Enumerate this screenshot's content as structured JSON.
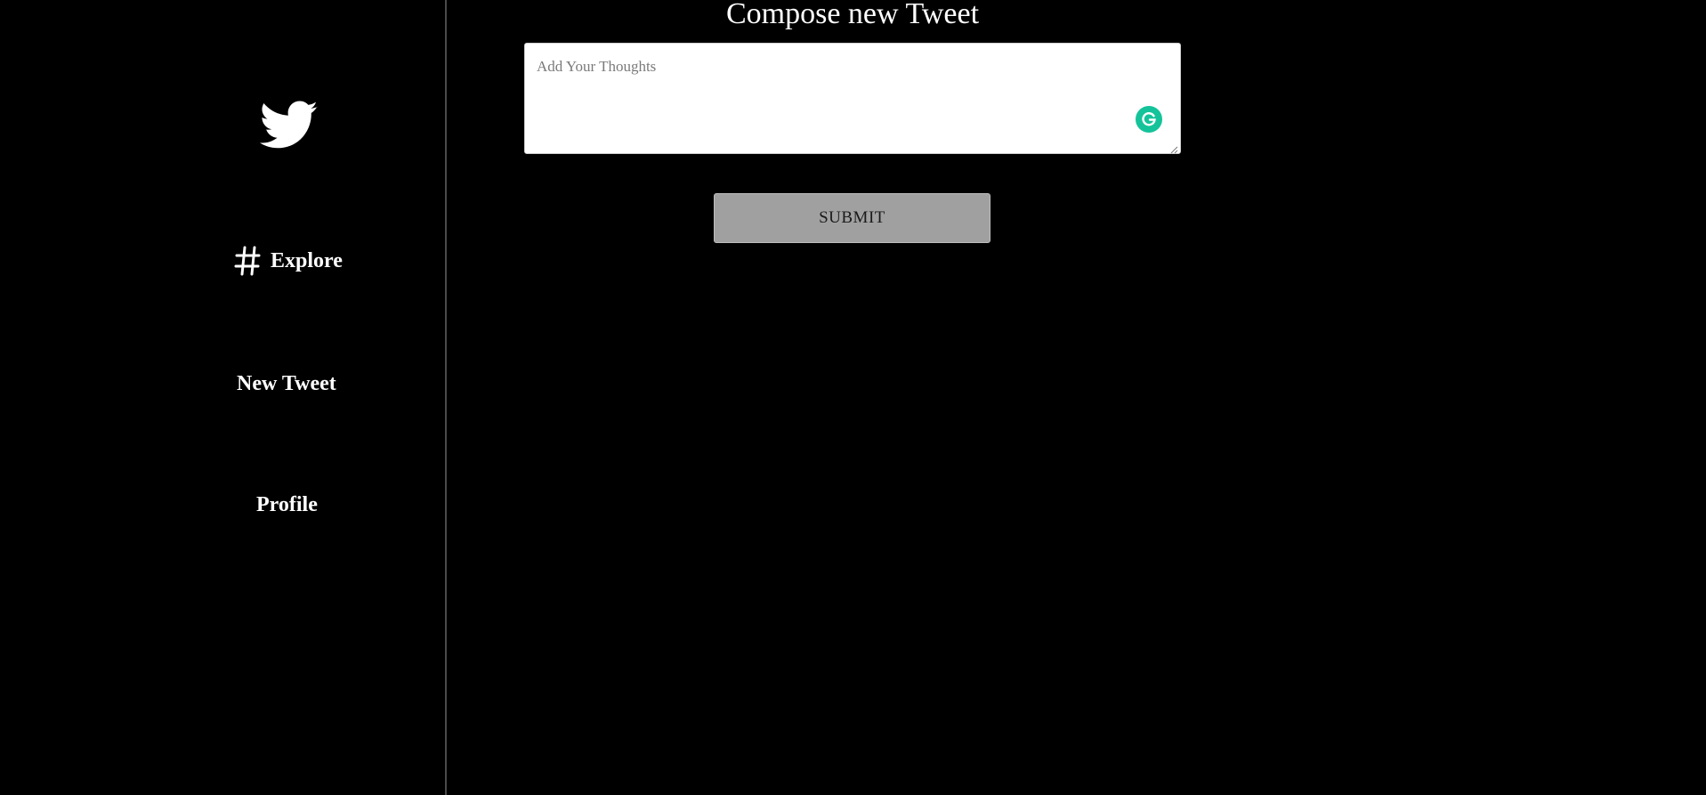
{
  "sidebar": {
    "logo_icon": "twitter-bird-icon",
    "items": [
      {
        "label": "Explore",
        "icon": "hashtag-icon"
      },
      {
        "label": "New Tweet"
      },
      {
        "label": "Profile"
      }
    ]
  },
  "main": {
    "title": "Compose new Tweet",
    "compose": {
      "placeholder": "Add Your Thoughts",
      "value": ""
    },
    "submit_label": "SUBMIT"
  },
  "colors": {
    "background": "#000000",
    "text": "#ffffff",
    "divider": "#4a4a4a",
    "submit_bg": "#a0a0a0",
    "grammarly": "#15c39a"
  }
}
